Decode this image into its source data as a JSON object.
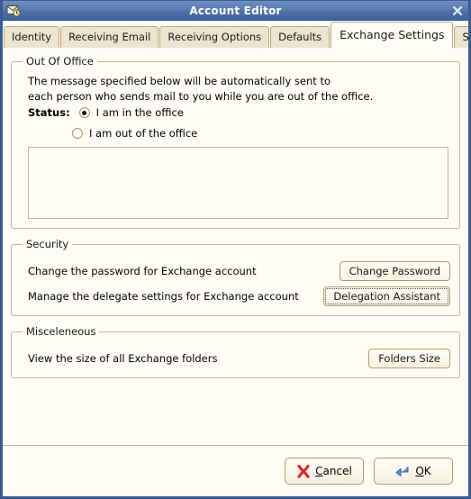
{
  "window": {
    "title": "Account Editor",
    "icon": "envelope-clock-icon",
    "close_label": "✕",
    "border_color": "#3b5c8f",
    "titlebar_color": "#4f71a8",
    "background_color": "#fffdf6",
    "group_border_color": "#c5b487"
  },
  "tabs": [
    {
      "label": "Identity",
      "active": false
    },
    {
      "label": "Receiving Email",
      "active": false
    },
    {
      "label": "Receiving Options",
      "active": false
    },
    {
      "label": "Defaults",
      "active": false
    },
    {
      "label": "Exchange Settings",
      "active": true
    },
    {
      "label": "Security",
      "active": false
    }
  ],
  "out_of_office": {
    "legend": "Out Of Office",
    "description_line1": "The message specified below will be automatically sent to",
    "description_line2": "each person who sends mail to you while you are out of the office.",
    "status_label": "Status:",
    "option_in_office": "I am in the office",
    "option_out_of_office": "I am out of the office",
    "selected": "in_office",
    "message_value": "",
    "message_placeholder": ""
  },
  "security": {
    "legend": "Security",
    "rows": [
      {
        "label": "Change the password for Exchange account",
        "button": "Change Password",
        "focused": false
      },
      {
        "label": "Manage the delegate settings for Exchange account",
        "button": "Delegation Assistant",
        "focused": true
      }
    ]
  },
  "misceleneous": {
    "legend": "Misceleneous",
    "rows": [
      {
        "label": "View the size of all Exchange folders",
        "button": "Folders Size",
        "focused": false
      }
    ]
  },
  "footer": {
    "cancel": {
      "prefix": "",
      "mnemonic": "C",
      "suffix": "ancel",
      "icon": "red-x-icon",
      "icon_color": "#d42b2b"
    },
    "ok": {
      "prefix": "",
      "mnemonic": "O",
      "suffix": "K",
      "icon": "blue-enter-arrow-icon",
      "icon_color": "#3a76c4"
    }
  }
}
